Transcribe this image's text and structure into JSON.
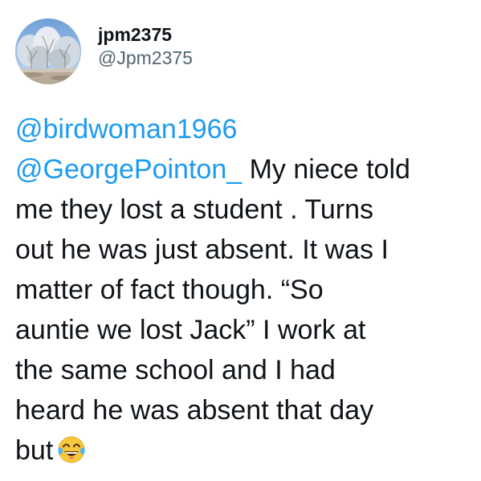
{
  "author": {
    "display_name": "jpm2375",
    "handle": "@Jpm2375",
    "avatar_icon": "snowy-trees-avatar"
  },
  "tweet": {
    "mention_1": "@birdwoman1966",
    "mention_2": "@GeorgePointon_",
    "line_2_text": " My niece told",
    "line_3": "me they lost a student . Turns",
    "line_4": "out he was just absent. It was I",
    "line_5": "matter of fact though. “So",
    "line_6": "auntie we lost Jack” I work at",
    "line_7": "the same school and I had",
    "line_8": "heard he was absent that day",
    "line_9": "but",
    "emoji_icon": "face-with-tears-of-joy-icon"
  },
  "colors": {
    "text": "#0f1419",
    "secondary": "#536471",
    "link": "#1d9bf0",
    "background": "#ffffff"
  }
}
